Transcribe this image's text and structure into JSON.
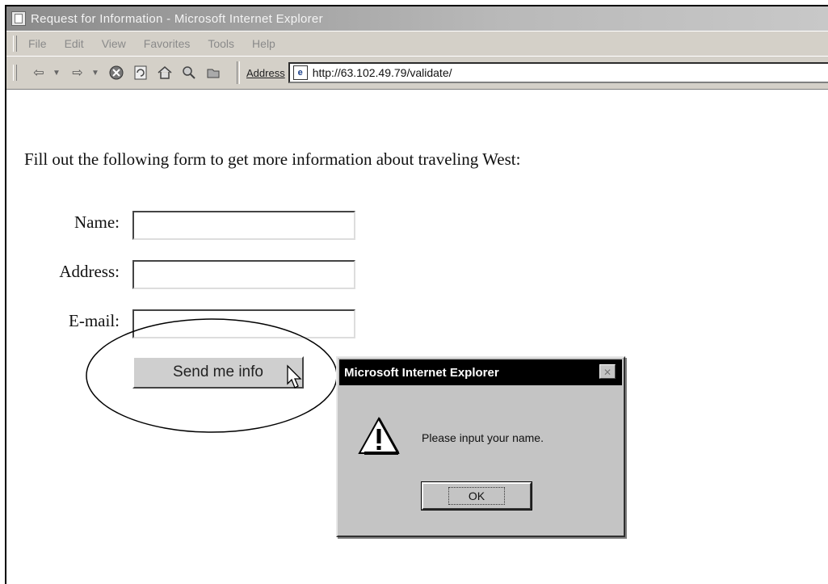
{
  "window": {
    "title": "Request for Information - Microsoft Internet Explorer"
  },
  "menu": {
    "items": [
      "File",
      "Edit",
      "View",
      "Favorites",
      "Tools",
      "Help"
    ]
  },
  "toolbar": {
    "icons": [
      "back-icon",
      "forward-icon",
      "stop-icon",
      "refresh-icon",
      "home-icon",
      "search-icon",
      "favorites-icon"
    ],
    "address_label": "Address",
    "address_url": "http://63.102.49.79/validate/"
  },
  "page": {
    "intro": "Fill out the following form to get more information about traveling West:",
    "fields": [
      {
        "label": "Name:",
        "value": ""
      },
      {
        "label": "Address:",
        "value": ""
      },
      {
        "label": "E-mail:",
        "value": ""
      }
    ],
    "submit_label": "Send me info"
  },
  "dialog": {
    "title": "Microsoft Internet Explorer",
    "message": "Please input your name.",
    "ok_label": "OK",
    "icon": "warning-icon"
  }
}
